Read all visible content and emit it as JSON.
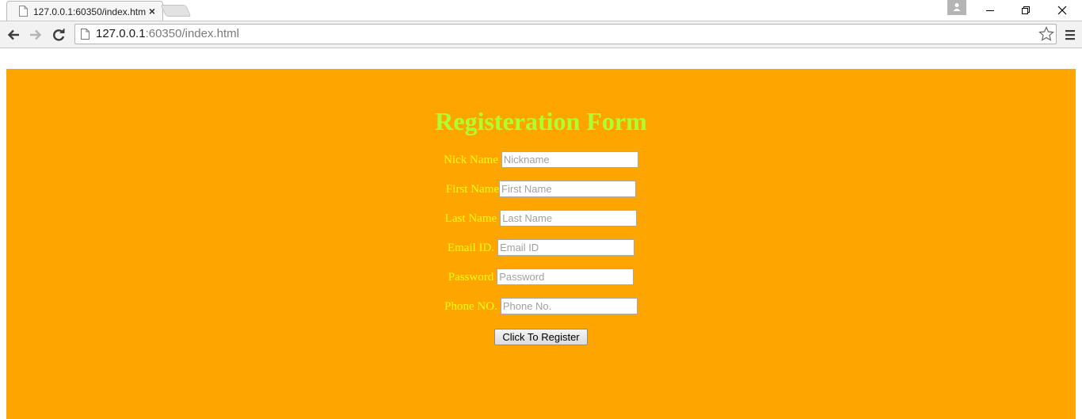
{
  "browser": {
    "tab_title": "127.0.0.1:60350/index.htm",
    "tab_close": "×",
    "url_host": "127.0.0.1",
    "url_path": ":60350/index.html"
  },
  "form": {
    "title": "Registeration Form",
    "fields": [
      {
        "label": "Nick Name",
        "placeholder": "Nickname"
      },
      {
        "label": "First Name",
        "placeholder": "First Name"
      },
      {
        "label": "Last Name",
        "placeholder": "Last Name"
      },
      {
        "label": "Email ID.",
        "placeholder": "Email ID"
      },
      {
        "label": "Password",
        "placeholder": "Password"
      },
      {
        "label": "Phone NO.",
        "placeholder": "Phone No."
      }
    ],
    "submit_label": "Click To Register"
  },
  "colors": {
    "panel_background": "#ffa500",
    "title_color": "#adff2f",
    "label_color": "#ffff00"
  }
}
